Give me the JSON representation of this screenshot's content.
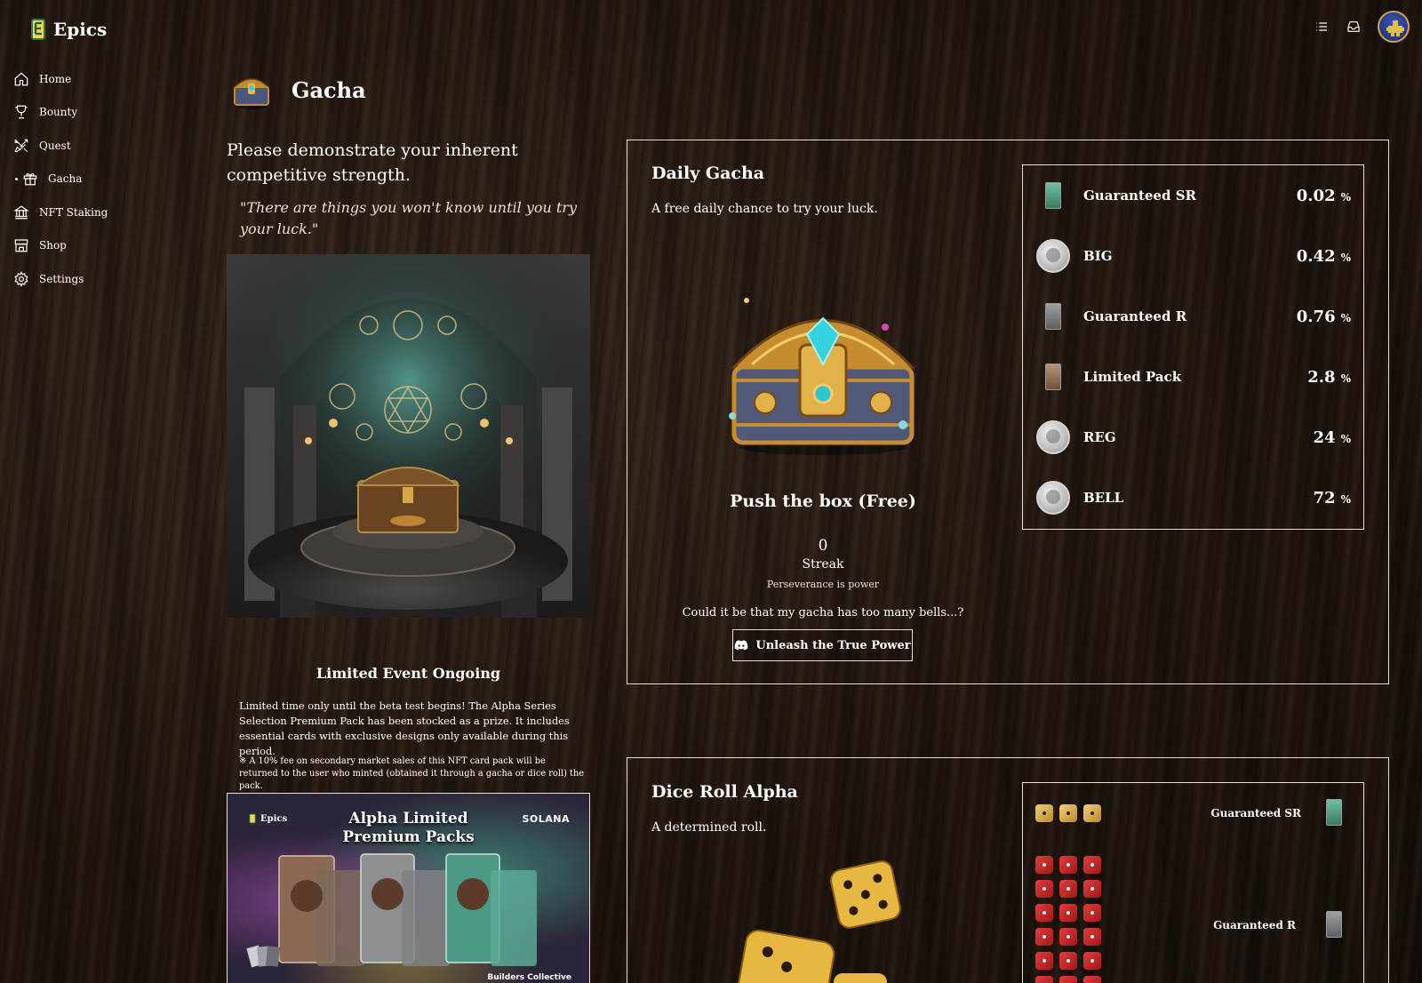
{
  "app": {
    "name": "Epics"
  },
  "sidebar": {
    "items": [
      {
        "label": "Home",
        "icon": "home-icon"
      },
      {
        "label": "Bounty",
        "icon": "trophy-icon"
      },
      {
        "label": "Quest",
        "icon": "swords-icon"
      },
      {
        "label": "Gacha",
        "icon": "gift-icon",
        "active": true
      },
      {
        "label": "NFT Staking",
        "icon": "bank-icon"
      },
      {
        "label": "Shop",
        "icon": "store-icon"
      },
      {
        "label": "Settings",
        "icon": "gear-icon"
      }
    ]
  },
  "header": {
    "title": "Gacha"
  },
  "intro": {
    "lead": "Please demonstrate your inherent competitive strength.",
    "quote": "\"There are things you won't know until you try your luck.\""
  },
  "event": {
    "title": "Limited Event Ongoing",
    "description": "Limited time only until the beta test begins! The Alpha Series Selection Premium Pack has been stocked as a prize. It includes essential cards with exclusive designs only available during this period.",
    "note": "※ A 10% fee on secondary market sales of this NFT card pack will be returned to the user who minted (obtained it through a gacha or dice roll) the pack.",
    "banner": {
      "brand": "Epics",
      "title_line1": "Alpha Limited",
      "title_line2": "Premium Packs",
      "partner": "SOLANA",
      "footer": "Builders Collective"
    }
  },
  "daily_gacha": {
    "title": "Daily Gacha",
    "subtitle": "A free daily chance to try your luck.",
    "push_label": "Push the box (Free)",
    "streak_value": "0",
    "streak_label": "Streak",
    "streak_sub": "Perseverance is power",
    "bells_text": "Could it be that my gacha has too many bells...?",
    "button_label": "Unleash the True Power",
    "odds": [
      {
        "name": "Guaranteed SR",
        "value": "0.02",
        "unit": "%",
        "thumb": "card",
        "color": "#5fa88a"
      },
      {
        "name": "BIG",
        "value": "0.42",
        "unit": "%",
        "thumb": "coin"
      },
      {
        "name": "Guaranteed R",
        "value": "0.76",
        "unit": "%",
        "thumb": "card",
        "color": "#8a8a8a"
      },
      {
        "name": "Limited Pack",
        "value": "2.8",
        "unit": "%",
        "thumb": "card",
        "color": "#9a7b62"
      },
      {
        "name": "REG",
        "value": "24",
        "unit": "%",
        "thumb": "coin"
      },
      {
        "name": "BELL",
        "value": "72",
        "unit": "%",
        "thumb": "coin"
      }
    ]
  },
  "dice_roll": {
    "title": "Dice Roll Alpha",
    "subtitle": "A determined roll.",
    "rows": [
      {
        "label": "Guaranteed SR"
      },
      {
        "label": "Guaranteed R"
      }
    ]
  },
  "colors": {
    "border": "#e8e0d6",
    "gold": "#d4a53b",
    "text": "#ffffff"
  }
}
